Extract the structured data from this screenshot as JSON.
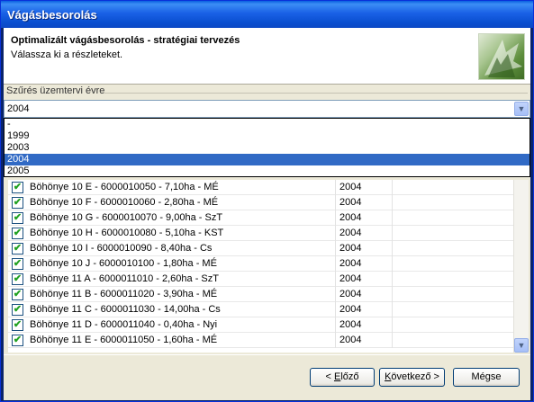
{
  "window": {
    "title": "Vágásbesorolás"
  },
  "header": {
    "title": "Optimalizált vágásbesorolás - stratégiai tervezés",
    "subtitle": "Válassza ki a részleteket."
  },
  "filter": {
    "label": "Szűrés üzemtervi évre",
    "selected": "2004",
    "options": [
      "-",
      "1999",
      "2003",
      "2004",
      "2005"
    ],
    "highlighted_option": "2004"
  },
  "list": {
    "rows": [
      {
        "name": "Böhönye 10 E - 6000010050 - 7,10ha - MÉ",
        "year": "2004",
        "checked": true
      },
      {
        "name": "Böhönye 10 F - 6000010060 - 2,80ha - MÉ",
        "year": "2004",
        "checked": true
      },
      {
        "name": "Böhönye 10 G - 6000010070 - 9,00ha - SzT",
        "year": "2004",
        "checked": true
      },
      {
        "name": "Böhönye 10 H - 6000010080 - 5,10ha - KST",
        "year": "2004",
        "checked": true
      },
      {
        "name": "Böhönye 10 I - 6000010090 - 8,40ha - Cs",
        "year": "2004",
        "checked": true
      },
      {
        "name": "Böhönye 10 J - 6000010100 - 1,80ha - MÉ",
        "year": "2004",
        "checked": true
      },
      {
        "name": "Böhönye 11 A - 6000011010 - 2,60ha - SzT",
        "year": "2004",
        "checked": true
      },
      {
        "name": "Böhönye 11 B - 6000011020 - 3,90ha - MÉ",
        "year": "2004",
        "checked": true
      },
      {
        "name": "Böhönye 11 C - 6000011030 - 14,00ha - Cs",
        "year": "2004",
        "checked": true
      },
      {
        "name": "Böhönye 11 D - 6000011040 - 0,40ha - Nyi",
        "year": "2004",
        "checked": true
      },
      {
        "name": "Böhönye 11 E - 6000011050 - 1,60ha - MÉ",
        "year": "2004",
        "checked": true
      }
    ]
  },
  "buttons": {
    "prev_pre": "< ",
    "prev_mnemonic": "E",
    "prev_post": "lőző",
    "next_pre": "",
    "next_mnemonic": "K",
    "next_post": "övetkező >",
    "cancel": "Mégse"
  },
  "colors": {
    "titlebar": "#0a5fe0",
    "selection": "#316ac5"
  }
}
